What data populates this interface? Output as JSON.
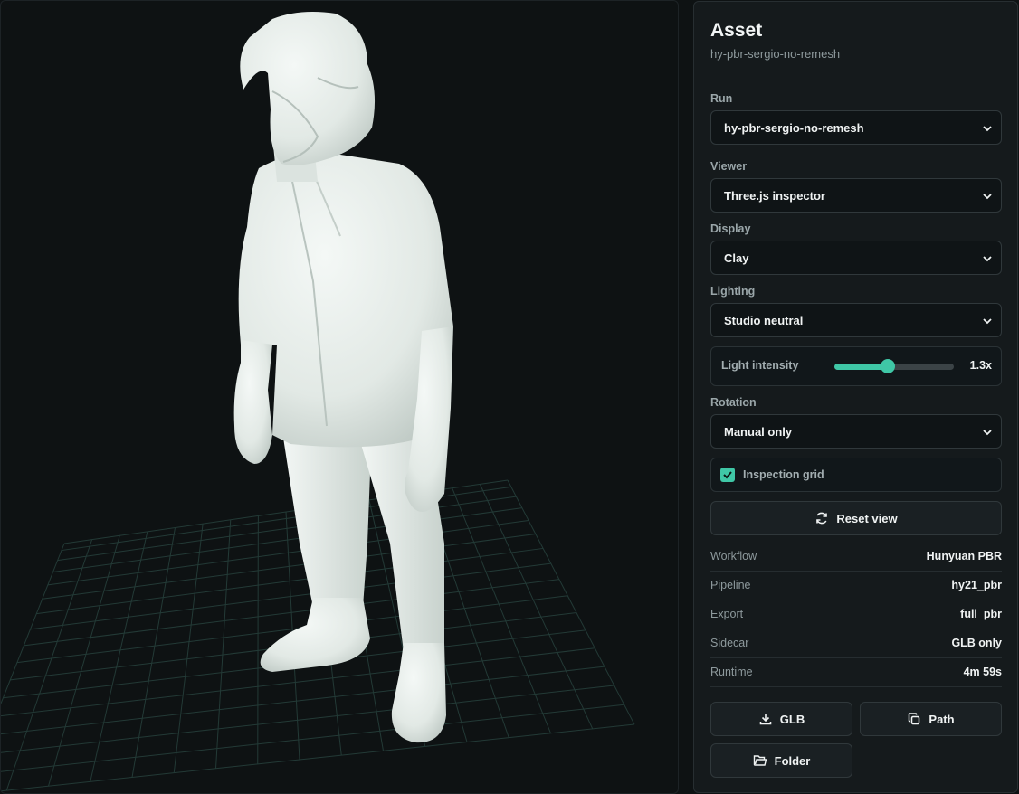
{
  "asset": {
    "title": "Asset",
    "name": "hy-pbr-sergio-no-remesh"
  },
  "run": {
    "label": "Run",
    "value": "hy-pbr-sergio-no-remesh"
  },
  "viewer": {
    "label": "Viewer",
    "value": "Three.js inspector"
  },
  "display": {
    "label": "Display",
    "value": "Clay"
  },
  "lighting": {
    "label": "Lighting",
    "value": "Studio neutral"
  },
  "light_intensity": {
    "label": "Light intensity",
    "value_text": "1.3x",
    "fraction": 0.45
  },
  "rotation": {
    "label": "Rotation",
    "value": "Manual only"
  },
  "inspection_grid": {
    "label": "Inspection grid",
    "checked": true
  },
  "reset_view": {
    "label": "Reset view"
  },
  "meta": [
    {
      "key": "Workflow",
      "value": "Hunyuan PBR"
    },
    {
      "key": "Pipeline",
      "value": "hy21_pbr"
    },
    {
      "key": "Export",
      "value": "full_pbr"
    },
    {
      "key": "Sidecar",
      "value": "GLB only"
    },
    {
      "key": "Runtime",
      "value": "4m 59s"
    }
  ],
  "actions": {
    "glb": "GLB",
    "path": "Path",
    "folder": "Folder"
  },
  "icons": {
    "chevron": "chevron-down-icon",
    "reset": "refresh-icon",
    "glb": "download-icon",
    "path": "copy-icon",
    "folder": "folder-icon",
    "check": "check-icon"
  },
  "colors": {
    "accent": "#3fc7a6",
    "panel": "#151a1c",
    "viewport": "#0e1213",
    "clay": "#e6ece8"
  }
}
